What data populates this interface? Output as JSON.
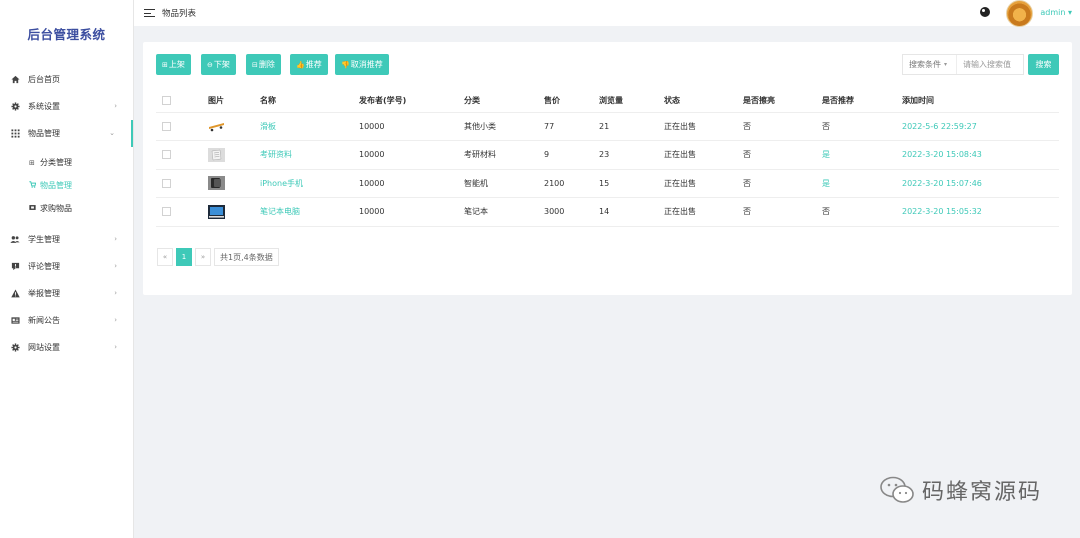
{
  "sidebar": {
    "brand": "后台管理系统",
    "items": [
      {
        "label": "后台首页",
        "icon": "home-icon",
        "has_arrow": false
      },
      {
        "label": "系统设置",
        "icon": "gear-icon",
        "has_arrow": true
      },
      {
        "label": "物品管理",
        "icon": "grid-icon",
        "has_arrow": true,
        "open": true
      },
      {
        "label": "学生管理",
        "icon": "users-icon",
        "has_arrow": true
      },
      {
        "label": "评论管理",
        "icon": "comment-alert-icon",
        "has_arrow": true
      },
      {
        "label": "举报管理",
        "icon": "warning-icon",
        "has_arrow": true
      },
      {
        "label": "新闻公告",
        "icon": "newspaper-icon",
        "has_arrow": true
      },
      {
        "label": "网站设置",
        "icon": "gear-icon",
        "has_arrow": true
      }
    ],
    "sub_items": [
      {
        "label": "分类管理",
        "icon": "table-icon",
        "active": false
      },
      {
        "label": "物品管理",
        "icon": "cart-icon",
        "active": true
      },
      {
        "label": "求购物品",
        "icon": "square-icon",
        "active": false
      }
    ]
  },
  "topbar": {
    "title": "物品列表",
    "user": "admin",
    "user_caret": "▾"
  },
  "toolbar": {
    "buttons": [
      {
        "label": "上架",
        "icon": "plus-square-icon"
      },
      {
        "label": "下架",
        "icon": "minus-circle-icon"
      },
      {
        "label": "删除",
        "icon": "trash-icon"
      },
      {
        "label": "推荐",
        "icon": "thumbs-up-icon"
      },
      {
        "label": "取消推荐",
        "icon": "thumbs-down-icon"
      }
    ],
    "search_select": "搜索条件",
    "search_placeholder": "请输入搜索值",
    "search_button": "搜索"
  },
  "table": {
    "headers": [
      "",
      "图片",
      "名称",
      "发布者(学号)",
      "分类",
      "售价",
      "浏览量",
      "状态",
      "是否擦亮",
      "是否推荐",
      "添加时间"
    ],
    "rows": [
      {
        "name": "滑板",
        "publisher": "10000",
        "category": "其他小类",
        "price": "77",
        "views": "21",
        "status": "正在出售",
        "polished": "否",
        "recommended": "否",
        "time": "2022-5-6 22:59:27",
        "thumb": "skateboard"
      },
      {
        "name": "考研资料",
        "publisher": "10000",
        "category": "考研材料",
        "price": "9",
        "views": "23",
        "status": "正在出售",
        "polished": "否",
        "recommended": "是",
        "time": "2022-3-20 15:08:43",
        "thumb": "books"
      },
      {
        "name": "iPhone手机",
        "publisher": "10000",
        "category": "智能机",
        "price": "2100",
        "views": "15",
        "status": "正在出售",
        "polished": "否",
        "recommended": "是",
        "time": "2022-3-20 15:07:46",
        "thumb": "phone"
      },
      {
        "name": "笔记本电脑",
        "publisher": "10000",
        "category": "笔记本",
        "price": "3000",
        "views": "14",
        "status": "正在出售",
        "polished": "否",
        "recommended": "否",
        "time": "2022-3-20 15:05:32",
        "thumb": "laptop"
      }
    ]
  },
  "pagination": {
    "prev": "«",
    "current": "1",
    "next": "»",
    "info": "共1页,4条数据"
  },
  "watermark": {
    "text": "码蜂窝源码"
  },
  "colors": {
    "accent": "#3ec9b8",
    "brand": "#3c4ea0"
  }
}
